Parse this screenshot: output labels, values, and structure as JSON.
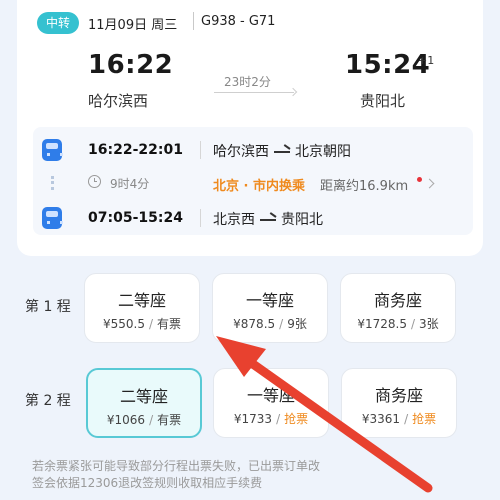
{
  "header": {
    "tag": "中转",
    "date": "11月09日 周三",
    "trains": "G938 - G71"
  },
  "journey": {
    "depart_time": "16:22",
    "depart_station": "哈尔滨西",
    "arrive_time": "15:24",
    "arrive_day_offset": "+1",
    "arrive_station": "贵阳北",
    "duration": "23时2分"
  },
  "legs": [
    {
      "times": "16:22-22:01",
      "from": "哈尔滨西",
      "to": "北京朝阳"
    },
    {
      "times": "07:05-15:24",
      "from": "北京西",
      "to": "贵阳北"
    }
  ],
  "transfer": {
    "layover": "9时4分",
    "type": "北京 · 市内换乘",
    "distance": "距离约16.9km"
  },
  "rows": [
    {
      "label": "第 1 程",
      "seats": [
        {
          "name": "二等座",
          "price": "¥550.5",
          "status": "有票",
          "selected": true
        },
        {
          "name": "一等座",
          "price": "¥878.5",
          "status": "9张",
          "selected": false
        },
        {
          "name": "商务座",
          "price": "¥1728.5",
          "status": "3张",
          "selected": false
        }
      ]
    },
    {
      "label": "第 2 程",
      "seats": [
        {
          "name": "二等座",
          "price": "¥1066",
          "status": "有票",
          "selected": true
        },
        {
          "name": "一等座",
          "price": "¥1733",
          "status": "抢票",
          "selected": false
        },
        {
          "name": "商务座",
          "price": "¥3361",
          "status": "抢票",
          "selected": false
        }
      ]
    }
  ],
  "notice": [
    "若余票紧张可能导致部分行程出票失败，已出票订单改",
    "签会依据12306退改签规则收取相应手续费"
  ],
  "colors": {
    "accent": "#35c1d0",
    "train_icon": "#2f7de9",
    "orange": "#ef8a1e",
    "annotation_arrow": "#e8412f"
  }
}
